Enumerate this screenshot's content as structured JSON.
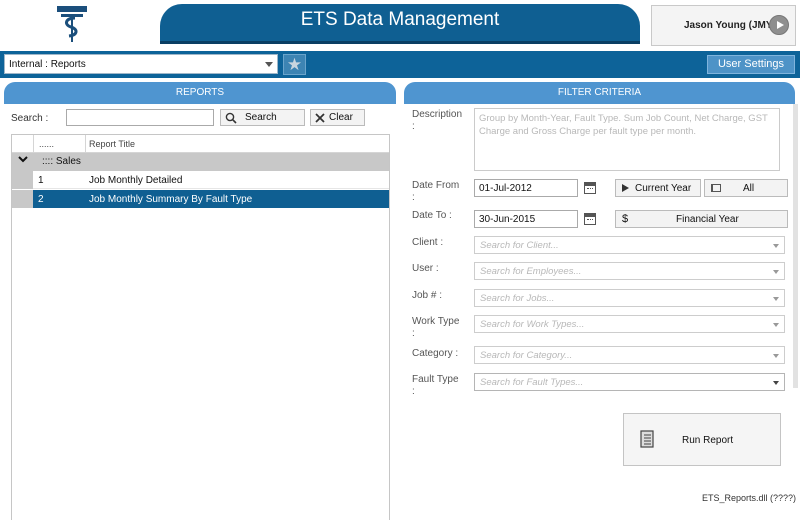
{
  "header": {
    "title": "ETS Data Management",
    "user_name": "Jason Young (JMY)"
  },
  "toolbar": {
    "report_select_value": "Internal : Reports",
    "user_settings_label": "User Settings"
  },
  "reports": {
    "tab_label": "REPORTS",
    "search_label": "Search :",
    "search_value": "",
    "search_button": "Search",
    "clear_button": "Clear",
    "columns": [
      "......",
      "Report Title"
    ],
    "group_name": ":::: Sales",
    "rows": [
      {
        "num": "1",
        "title": "Job Monthly Detailed",
        "selected": false
      },
      {
        "num": "2",
        "title": "Job Monthly Summary By Fault Type",
        "selected": true
      }
    ]
  },
  "filter": {
    "tab_label": "FILTER CRITERIA",
    "description_label": "Description\n:",
    "description_text": "Group by Month-Year, Fault Type. Sum Job Count, Net Charge, GST Charge and Gross Charge per fault type per month.",
    "date_from_label": "Date From\n:",
    "date_from_value": "01-Jul-2012",
    "date_to_label": "Date To :",
    "date_to_value": "30-Jun-2015",
    "current_year_label": "Current Year",
    "all_label": "All",
    "financial_year_label": "Financial Year",
    "client_label": "Client :",
    "client_placeholder": "Search for Client...",
    "user_label": "User :",
    "user_placeholder": "Search for Employees...",
    "job_label": "Job # :",
    "job_placeholder": "Search for Jobs...",
    "work_type_label": "Work Type\n:",
    "work_type_placeholder": "Search for Work Types...",
    "category_label": "Category :",
    "category_placeholder": "Search for Category...",
    "fault_type_label": "Fault Type\n:",
    "fault_type_placeholder": "Search for Fault Types...",
    "run_report_label": "Run Report"
  },
  "footer": {
    "text": "ETS_Reports.dll (????)"
  },
  "colors": {
    "brand_blue": "#0f5f92",
    "tab_blue": "#4f95d0",
    "selected_row": "#0f5f92"
  }
}
